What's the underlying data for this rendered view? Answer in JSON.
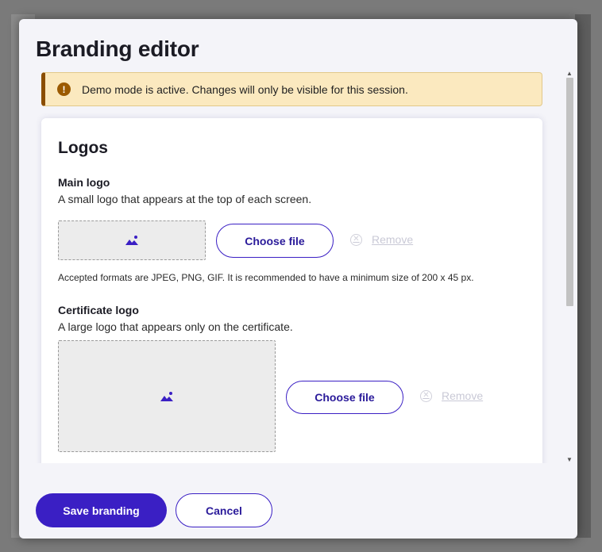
{
  "dialog": {
    "title": "Branding editor"
  },
  "alert": {
    "icon": "warning-icon",
    "text": "Demo mode is active. Changes will only be visible for this session."
  },
  "logos": {
    "section_title": "Logos",
    "main_logo": {
      "label": "Main logo",
      "description": "A small logo that appears at the top of each screen.",
      "choose_label": "Choose file",
      "remove_label": "Remove",
      "hint": "Accepted formats are JPEG, PNG, GIF. It is recommended to have a minimum size of 200 x 45 px."
    },
    "certificate_logo": {
      "label": "Certificate logo",
      "description": "A large logo that appears only on the certificate.",
      "choose_label": "Choose file",
      "remove_label": "Remove"
    }
  },
  "footer": {
    "save_label": "Save branding",
    "cancel_label": "Cancel"
  },
  "colors": {
    "primary": "#3a1fc4",
    "alert_bg": "#fbe9bf",
    "alert_accent": "#8a4d00",
    "disabled": "#c9c9d6"
  }
}
